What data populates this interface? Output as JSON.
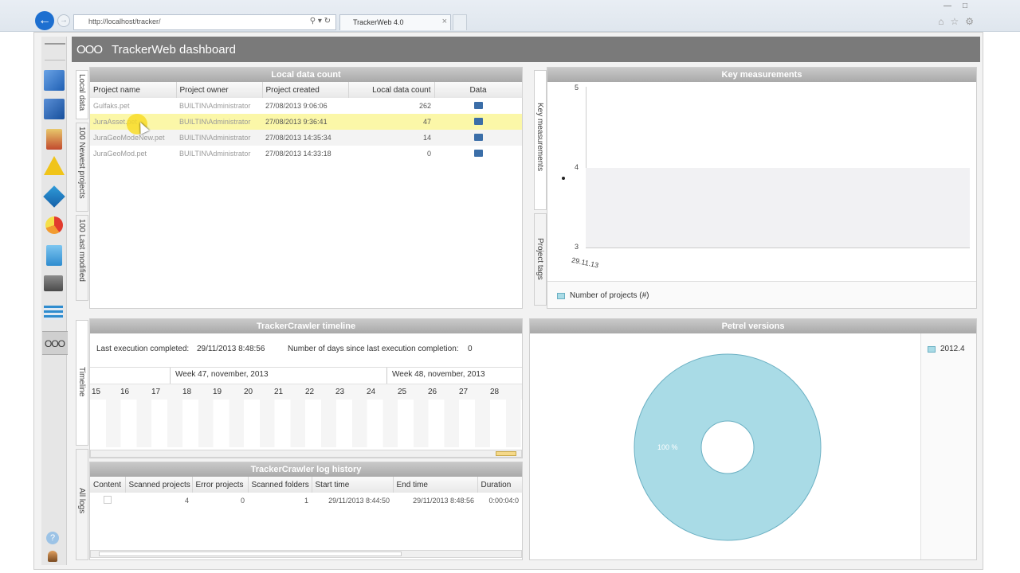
{
  "browser": {
    "url": "http://localhost/tracker/",
    "tab_title": "TrackerWeb 4.0"
  },
  "header": {
    "logo": "OOO",
    "title": "TrackerWeb dashboard"
  },
  "sidebar": {
    "icons": [
      "document-blue-icon",
      "folder-blue-icon",
      "project-tree-icon",
      "warning-icon",
      "layers-icon",
      "pie-chart-icon",
      "book-icon",
      "database-icon",
      "grid-icon",
      "ooo-icon",
      "help-icon",
      "user-icon"
    ],
    "active_label": "OOO"
  },
  "local_data": {
    "title": "Local data count",
    "vtabs": [
      "Local data",
      "100 Newest projects",
      "100 Last modified"
    ],
    "columns": [
      "Project name",
      "Project owner",
      "Project created",
      "Local data count",
      "Data"
    ],
    "rows": [
      {
        "name": "Gulfaks.pet",
        "owner": "BUILTIN\\Administrator",
        "created": "27/08/2013 9:06:06",
        "count": "262"
      },
      {
        "name": "JuraAsset.pet",
        "owner": "BUILTIN\\Administrator",
        "created": "27/08/2013 9:36:41",
        "count": "47"
      },
      {
        "name": "JuraGeoModeNew.pet",
        "owner": "BUILTIN\\Administrator",
        "created": "27/08/2013 14:35:34",
        "count": "14"
      },
      {
        "name": "JuraGeoMod.pet",
        "owner": "BUILTIN\\Administrator",
        "created": "27/08/2013 14:33:18",
        "count": "0"
      }
    ]
  },
  "key_measurements": {
    "title": "Key measurements",
    "vtabs": [
      "Key measurements",
      "Project tags"
    ],
    "y_ticks": [
      "5",
      "4",
      "3"
    ],
    "x_tick": "29.11.13",
    "legend": "Number of projects (#)"
  },
  "timeline": {
    "title": "TrackerCrawler timeline",
    "vtab": "Timeline",
    "last_execution_label": "Last execution completed:",
    "last_execution_value": "29/11/2013 8:48:56",
    "days_since_label": "Number of days since last execution completion:",
    "days_since_value": "0",
    "weeks": [
      "Week 47, november, 2013",
      "Week 48, november, 2013"
    ],
    "days": [
      "15",
      "16",
      "17",
      "18",
      "19",
      "20",
      "21",
      "22",
      "23",
      "24",
      "25",
      "26",
      "27",
      "28"
    ]
  },
  "log_history": {
    "title": "TrackerCrawler log history",
    "vtab": "All logs",
    "columns": [
      "Content",
      "Scanned projects",
      "Error projects",
      "Scanned folders",
      "Start time",
      "End time",
      "Duration"
    ],
    "rows": [
      {
        "scanned_projects": "4",
        "error_projects": "0",
        "scanned_folders": "1",
        "start": "29/11/2013 8:44:50",
        "end": "29/11/2013 8:48:56",
        "duration": "0:00:04:0"
      }
    ]
  },
  "petrel_versions": {
    "title": "Petrel versions",
    "legend": "2012.4",
    "slice_label": "100 %",
    "colors": {
      "slice": "#a9dbe6",
      "slice_stroke": "#6bb0c3"
    }
  },
  "chart_data": {
    "type": "pie",
    "categories": [
      "2012.4"
    ],
    "values": [
      100
    ],
    "title": "Petrel versions"
  }
}
